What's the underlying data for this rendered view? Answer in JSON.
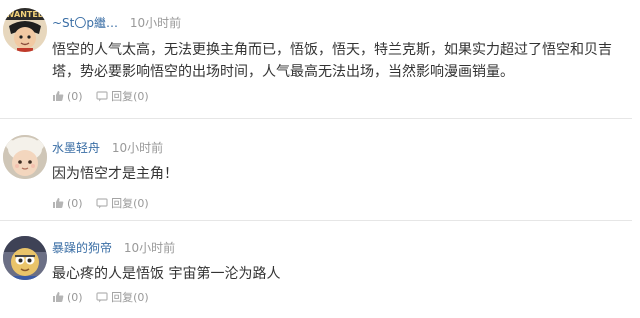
{
  "comments": [
    {
      "username": "~St〇p繼…",
      "time": "10小时前",
      "text": "悟空的人气太高，无法更换主角而已，悟饭，悟天，特兰克斯，如果实力超过了悟空和贝吉塔，势必要影响悟空的出场时间，人气最高无法出场，当然影响漫画销量。",
      "like_count": "(0)",
      "reply_label": "回复",
      "reply_count": "(0)",
      "avatar_badge": "WANTED"
    },
    {
      "username": "水墨轻舟",
      "time": "10小时前",
      "text": "因为悟空才是主角！",
      "like_count": "(0)",
      "reply_label": "回复",
      "reply_count": "(0)"
    },
    {
      "username": "暴躁的狗帝",
      "time": "10小时前",
      "text": "最心疼的人是悟饭  宇宙第一沦为路人",
      "like_count": "(0)",
      "reply_label": "回复",
      "reply_count": "(0)"
    }
  ],
  "icons": {
    "like": "thumbs-up-icon",
    "reply": "reply-icon"
  },
  "colors": {
    "username": "#3a6ea5",
    "meta": "#999999",
    "text": "#333333",
    "divider": "#e6e6e6"
  }
}
